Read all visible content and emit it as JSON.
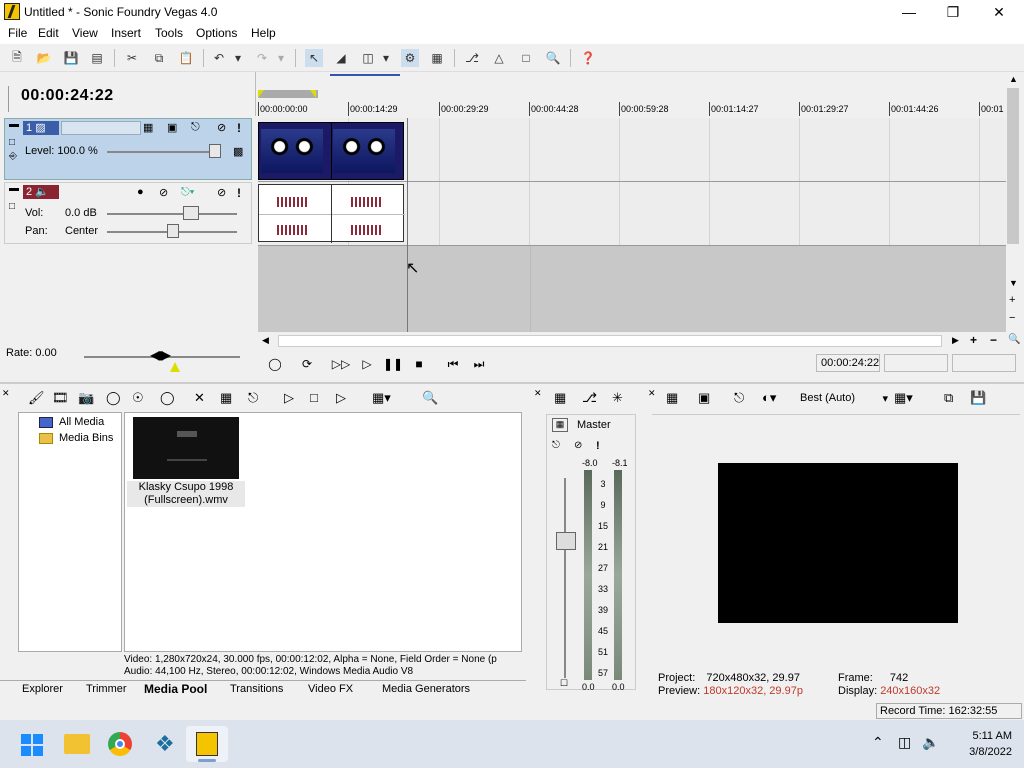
{
  "window": {
    "title": "Untitled * - Sonic Foundry Vegas 4.0"
  },
  "menu": [
    "File",
    "Edit",
    "View",
    "Insert",
    "Tools",
    "Options",
    "Help"
  ],
  "timeline": {
    "current_time": "00:00:24:22",
    "ruler_labels": [
      "00:00:00:00",
      "00:00:14:29",
      "00:00:29:29",
      "00:00:44:28",
      "00:00:59:28",
      "00:01:14:27",
      "00:01:29:27",
      "00:01:44:26",
      "00:01"
    ]
  },
  "track1": {
    "number": "1",
    "level_label": "Level: 100.0 %"
  },
  "track2": {
    "number": "2",
    "vol_label": "Vol:",
    "vol_value": "0.0 dB",
    "pan_label": "Pan:",
    "pan_value": "Center"
  },
  "rate": {
    "label": "Rate: 0.00"
  },
  "transport": {
    "time": "00:00:24:22"
  },
  "explorer": {
    "tree": [
      "All Media",
      "Media Bins"
    ],
    "media_item": {
      "name_line1": "Klasky Csupo 1998",
      "name_line2": "(Fullscreen).wmv"
    },
    "info_line1": "Video: 1,280x720x24, 30.000 fps, 00:00:12:02, Alpha = None, Field Order = None (p",
    "info_line2": "Audio: 44,100 Hz, Stereo, 00:00:12:02, Windows Media Audio V8",
    "tabs": [
      "Explorer",
      "Trimmer",
      "Media Pool",
      "Transitions",
      "Video FX",
      "Media Generators"
    ],
    "active_tab": "Media Pool"
  },
  "mixer": {
    "label": "Master",
    "peak_left": "-8.0",
    "peak_right": "-8.1",
    "scale": [
      "3",
      "9",
      "15",
      "21",
      "27",
      "33",
      "39",
      "45",
      "51",
      "57"
    ],
    "bottom_left": "0.0",
    "bottom_right": "0.0"
  },
  "preview": {
    "quality": "Best (Auto)",
    "project_label": "Project:",
    "project_value": "720x480x32, 29.97",
    "preview_label": "Preview:",
    "preview_value": "180x120x32, 29.97p",
    "frame_label": "Frame:",
    "frame_value": "742",
    "display_label": "Display:",
    "display_value": "240x160x32"
  },
  "status": {
    "record_time": "Record Time: 162:32:55"
  },
  "taskbar": {
    "time": "5:11 AM",
    "date": "3/8/2022"
  },
  "colors": {
    "track1_header": "#bcd3ea",
    "accent_red": "#c0392b"
  }
}
